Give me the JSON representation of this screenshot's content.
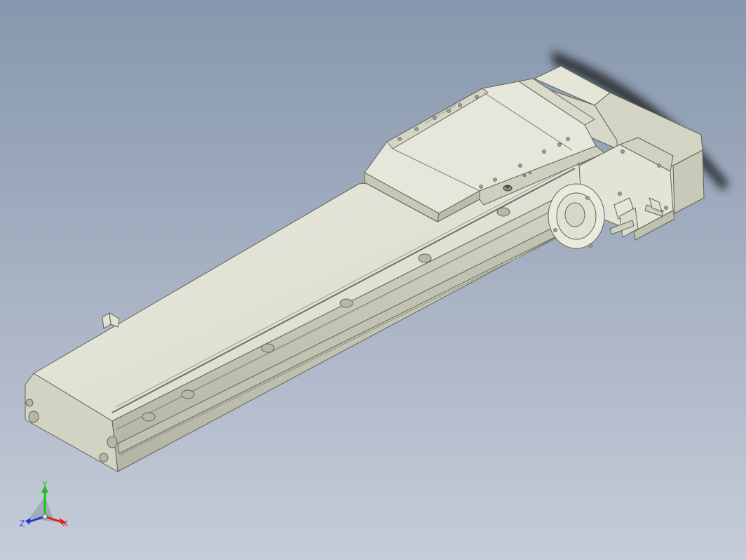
{
  "viewport": {
    "background_top": "#8797ad",
    "background_bottom": "#c6ccd9",
    "model": {
      "part_color": "#e4e4d6",
      "shade_color": "#c9c9b8",
      "dark_color": "#a9a999",
      "edge_color": "#5f6358"
    }
  },
  "triad": {
    "x_label": "X",
    "y_label": "Y",
    "z_label": "Z",
    "x_color": "#e0201b",
    "y_color": "#18c21a",
    "z_color": "#2436d8"
  }
}
